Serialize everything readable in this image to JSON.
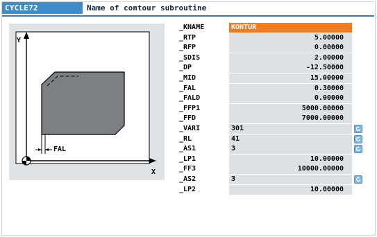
{
  "header": {
    "cycle_name": "CYCLE72",
    "description": "Name of contour subroutine"
  },
  "graphic": {
    "axis_y": "Y",
    "axis_x": "X",
    "fal_label": "FAL"
  },
  "params": [
    {
      "name": "_KNAME",
      "value": "KONTUR",
      "kind": "txt",
      "selected": true,
      "toggle": false
    },
    {
      "name": "_RTP",
      "value": "5.00000",
      "kind": "num",
      "selected": false,
      "toggle": false
    },
    {
      "name": "_RFP",
      "value": "0.00000",
      "kind": "num",
      "selected": false,
      "toggle": false
    },
    {
      "name": "_SDIS",
      "value": "2.00000",
      "kind": "num",
      "selected": false,
      "toggle": false
    },
    {
      "name": "_DP",
      "value": "-12.50000",
      "kind": "num",
      "selected": false,
      "toggle": false
    },
    {
      "name": "_MID",
      "value": "15.00000",
      "kind": "num",
      "selected": false,
      "toggle": false
    },
    {
      "name": "_FAL",
      "value": "0.30000",
      "kind": "num",
      "selected": false,
      "toggle": false
    },
    {
      "name": "_FALD",
      "value": "0.00000",
      "kind": "num",
      "selected": false,
      "toggle": false
    },
    {
      "name": "_FFP1",
      "value": "5000.00000",
      "kind": "num",
      "selected": false,
      "toggle": false
    },
    {
      "name": "_FFD",
      "value": "7000.00000",
      "kind": "num",
      "selected": false,
      "toggle": false
    },
    {
      "name": "_VARI",
      "value": "301",
      "kind": "txt",
      "selected": false,
      "toggle": true
    },
    {
      "name": "_RL",
      "value": "41",
      "kind": "txt",
      "selected": false,
      "toggle": true
    },
    {
      "name": "_AS1",
      "value": "3",
      "kind": "txt",
      "selected": false,
      "toggle": true
    },
    {
      "name": "_LP1",
      "value": "10.00000",
      "kind": "num",
      "selected": false,
      "toggle": false
    },
    {
      "name": "_FF3",
      "value": "10000.00000",
      "kind": "num",
      "selected": false,
      "toggle": false
    },
    {
      "name": "_AS2",
      "value": "3",
      "kind": "txt",
      "selected": false,
      "toggle": true
    },
    {
      "name": "_LP2",
      "value": "10.00000",
      "kind": "num",
      "selected": false,
      "toggle": false
    }
  ],
  "colors": {
    "header_blue": "#3f8cc6",
    "selected_orange": "#f07d22",
    "field_gray": "#dde1e4",
    "toggle_blue": "#7fb4e0"
  }
}
